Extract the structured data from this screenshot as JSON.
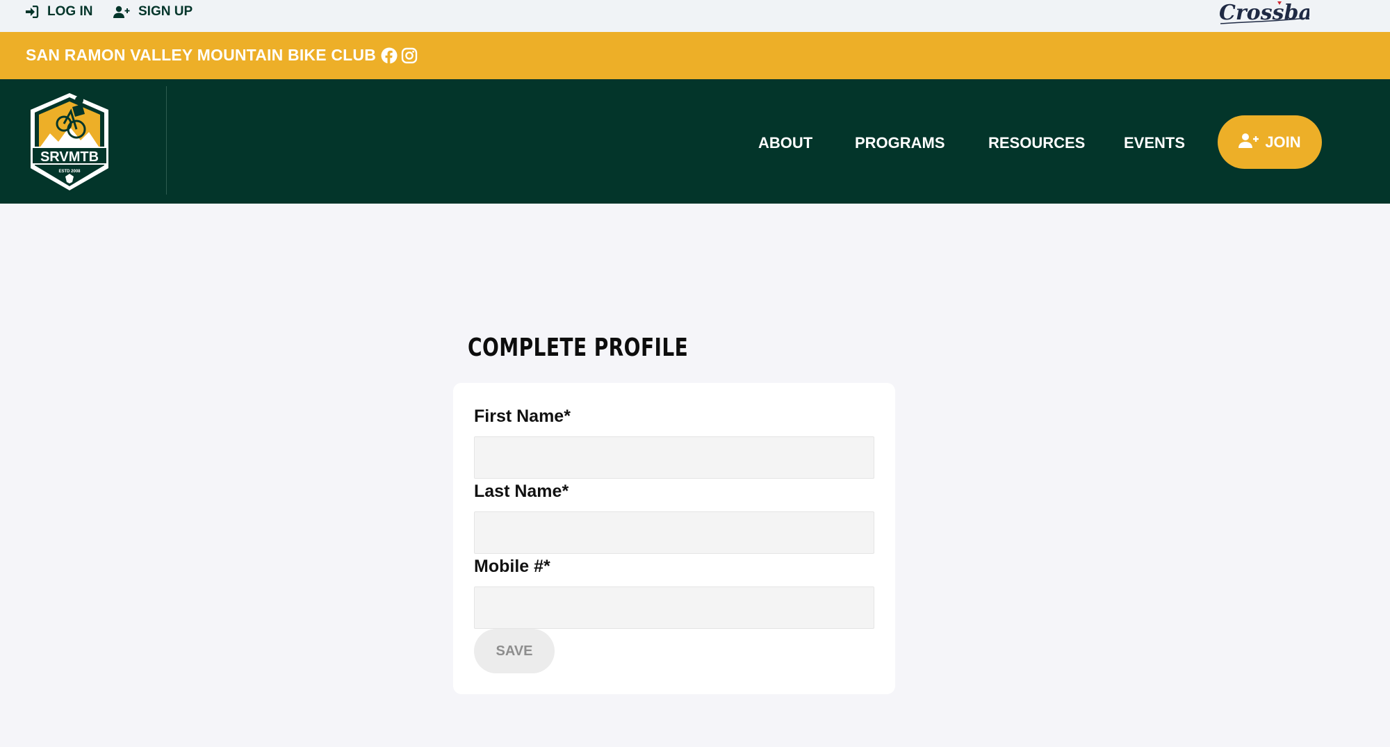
{
  "topbar": {
    "login_label": "LOG IN",
    "signup_label": "SIGN UP",
    "brand_logo_text": "Crossbar"
  },
  "club": {
    "name": "SAN RAMON VALLEY MOUNTAIN BIKE CLUB",
    "social_icons": [
      "facebook-icon",
      "instagram-icon"
    ]
  },
  "logo": {
    "text": "SRVMTB",
    "subtext": "ESTD 2008"
  },
  "nav": {
    "items": [
      {
        "label": "ABOUT"
      },
      {
        "label": "PROGRAMS"
      },
      {
        "label": "RESOURCES"
      },
      {
        "label": "EVENTS"
      }
    ],
    "join_label": "JOIN"
  },
  "form": {
    "title": "COMPLETE PROFILE",
    "fields": [
      {
        "label": "First Name*",
        "value": ""
      },
      {
        "label": "Last Name*",
        "value": ""
      },
      {
        "label": "Mobile #*",
        "value": ""
      }
    ],
    "save_label": "SAVE"
  },
  "colors": {
    "accent_yellow": "#edaf28",
    "brand_green": "#03352a",
    "page_background": "#f5f5f9",
    "input_background": "#f4f4f4",
    "save_disabled": "#ececec"
  }
}
